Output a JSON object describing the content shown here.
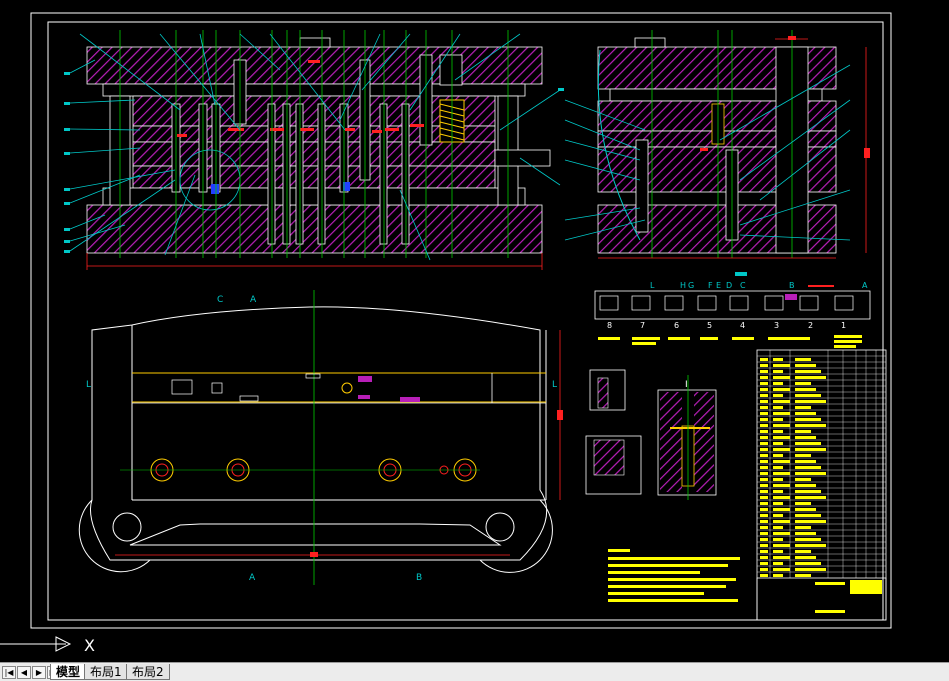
{
  "section_labels": {
    "c": "C",
    "a": "A",
    "b": "B",
    "l": "L",
    "i": "I"
  },
  "strip_station_letters": [
    "L",
    "H",
    "G",
    "F",
    "E",
    "D",
    "C",
    "B",
    "A"
  ],
  "strip_station_numbers": [
    "8",
    "7",
    "6",
    "5",
    "4",
    "3",
    "2",
    "1"
  ],
  "axis_label": "X",
  "tabs": {
    "first_label": "|◀",
    "prev_label": "◀",
    "next_label": "▶",
    "last_label": "▶|",
    "items": [
      {
        "label": "模型",
        "active": true
      },
      {
        "label": "布局1",
        "active": false
      },
      {
        "label": "布局2",
        "active": false
      }
    ]
  },
  "colors": {
    "background": "#000000",
    "hatch": "#b81fb8",
    "leader": "#00c8c8",
    "centerline": "#00cc00",
    "dimension": "#ff2020",
    "text_yellow": "#ffff00",
    "outline": "#ffffff"
  }
}
